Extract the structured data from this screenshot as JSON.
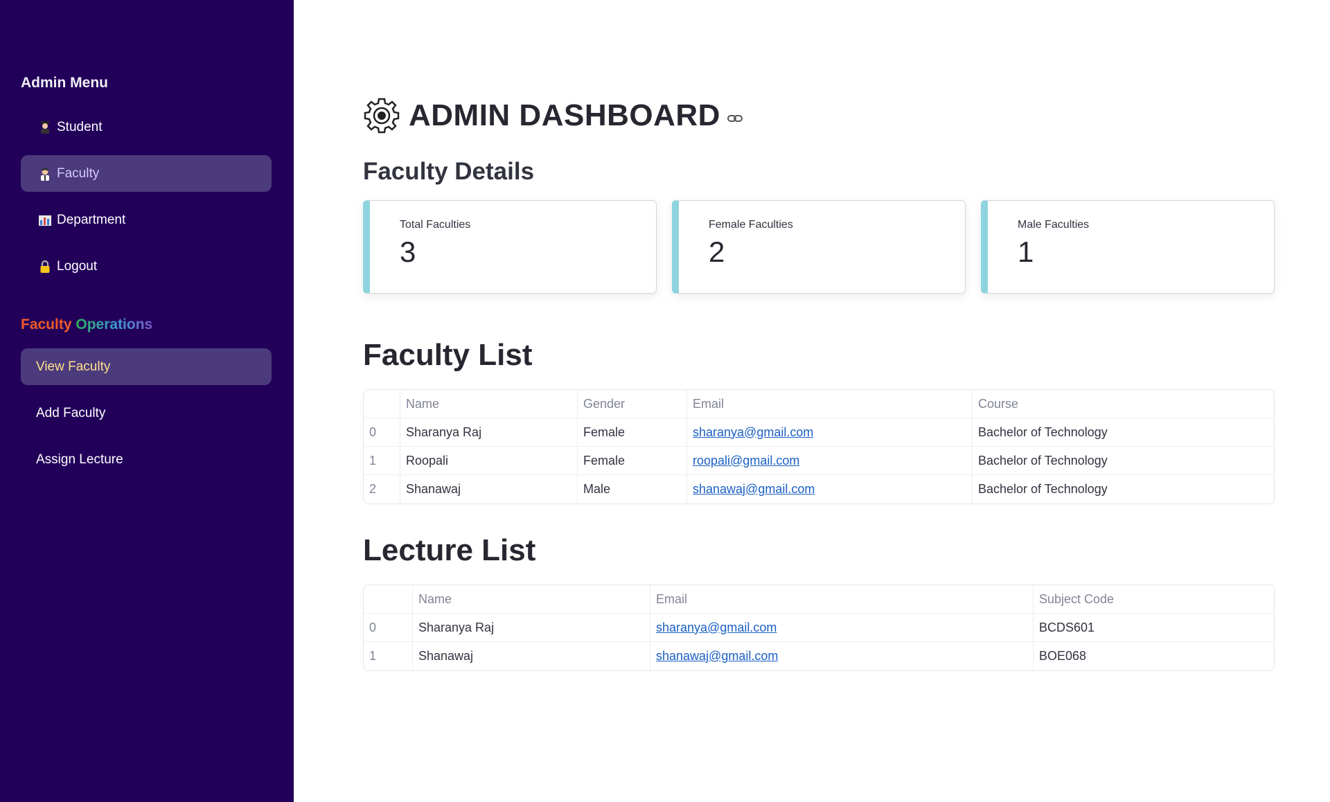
{
  "sidebar": {
    "heading": "Admin Menu",
    "menu": [
      {
        "icon": "student-icon",
        "label": "Student"
      },
      {
        "icon": "teacher-icon",
        "label": "Faculty"
      },
      {
        "icon": "building-chart-icon",
        "label": "Department"
      },
      {
        "icon": "lock-icon",
        "label": "Logout"
      }
    ],
    "operations_heading_1": "Faculty",
    "operations_heading_2": "Operations",
    "operations": [
      {
        "label": "View Faculty"
      },
      {
        "label": "Add Faculty"
      },
      {
        "label": "Assign Lecture"
      }
    ]
  },
  "main": {
    "title": "ADMIN DASHBOARD",
    "details_heading": "Faculty Details",
    "cards": [
      {
        "label": "Total Faculties",
        "value": "3"
      },
      {
        "label": "Female Faculties",
        "value": "2"
      },
      {
        "label": "Male Faculties",
        "value": "1"
      }
    ],
    "faculty_list": {
      "heading": "Faculty List",
      "columns": [
        "",
        "Name",
        "Gender",
        "Email",
        "Course"
      ],
      "rows": [
        {
          "idx": "0",
          "name": "Sharanya Raj",
          "gender": "Female",
          "email": "sharanya@gmail.com",
          "course": "Bachelor of Technology"
        },
        {
          "idx": "1",
          "name": "Roopali",
          "gender": "Female",
          "email": "roopali@gmail.com",
          "course": "Bachelor of Technology"
        },
        {
          "idx": "2",
          "name": "Shanawaj",
          "gender": "Male",
          "email": "shanawaj@gmail.com",
          "course": "Bachelor of Technology"
        }
      ]
    },
    "lecture_list": {
      "heading": "Lecture List",
      "columns": [
        "",
        "Name",
        "Email",
        "Subject Code"
      ],
      "rows": [
        {
          "idx": "0",
          "name": "Sharanya Raj",
          "email": "sharanya@gmail.com",
          "code": "BCDS601"
        },
        {
          "idx": "1",
          "name": "Shanawaj",
          "email": "shanawaj@gmail.com",
          "code": "BOE068"
        }
      ]
    }
  },
  "colors": {
    "sidebar_bg": "#22005a",
    "active_item_bg": "#4b3b7c",
    "card_accent": "#8ed4de",
    "link": "#1a5fc4",
    "active_sub_text": "#ffe08a"
  }
}
